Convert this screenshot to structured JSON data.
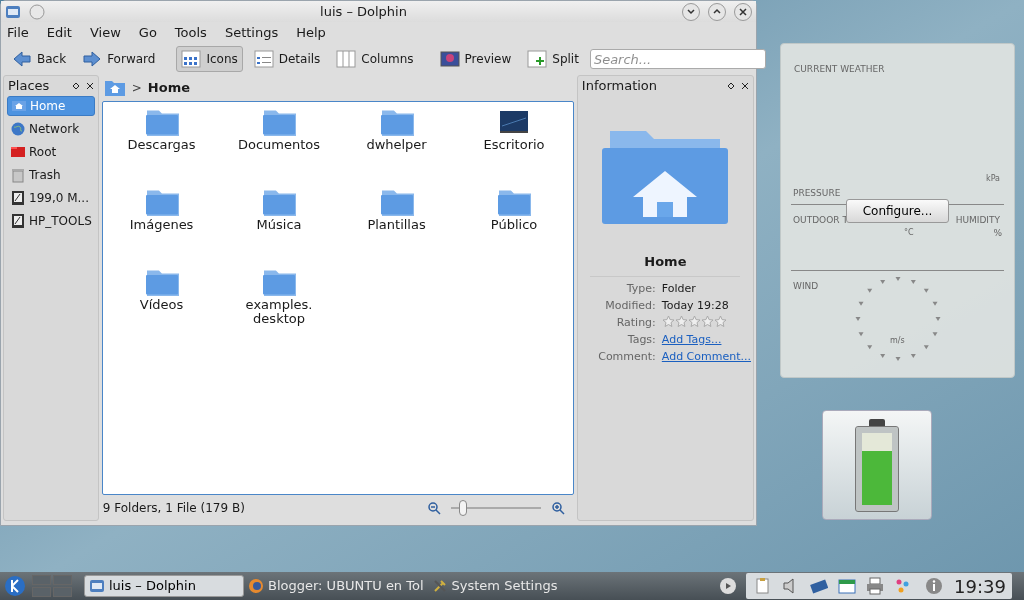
{
  "window": {
    "title": "luis – Dolphin"
  },
  "menu": [
    "File",
    "Edit",
    "View",
    "Go",
    "Tools",
    "Settings",
    "Help"
  ],
  "toolbar": [
    {
      "kind": "back",
      "label": "Back",
      "selected": false
    },
    {
      "kind": "forward",
      "label": "Forward",
      "selected": false
    },
    {
      "kind": "icons",
      "label": "Icons",
      "selected": true
    },
    {
      "kind": "details",
      "label": "Details",
      "selected": false
    },
    {
      "kind": "columns",
      "label": "Columns",
      "selected": false
    },
    {
      "kind": "preview",
      "label": "Preview",
      "selected": false
    },
    {
      "kind": "split",
      "label": "Split",
      "selected": false
    }
  ],
  "search": {
    "placeholder": "Search..."
  },
  "places": {
    "title": "Places",
    "items": [
      {
        "kind": "home",
        "label": "Home",
        "selected": true
      },
      {
        "kind": "network",
        "label": "Network",
        "selected": false
      },
      {
        "kind": "root",
        "label": "Root",
        "selected": false
      },
      {
        "kind": "trash",
        "label": "Trash",
        "selected": false
      },
      {
        "kind": "drive",
        "label": "199,0 M...",
        "selected": false
      },
      {
        "kind": "drive",
        "label": "HP_TOOLS",
        "selected": false
      }
    ]
  },
  "breadcrumb": {
    "separator": ">",
    "current": "Home"
  },
  "files": [
    {
      "kind": "folder",
      "name": "Descargas"
    },
    {
      "kind": "folder",
      "name": "Documentos"
    },
    {
      "kind": "folder",
      "name": "dwhelper"
    },
    {
      "kind": "desktop",
      "name": "Escritorio"
    },
    {
      "kind": "folder",
      "name": "Imágenes"
    },
    {
      "kind": "folder",
      "name": "Música"
    },
    {
      "kind": "folder",
      "name": "Plantillas"
    },
    {
      "kind": "folder",
      "name": "Público"
    },
    {
      "kind": "folder",
      "name": "Vídeos"
    },
    {
      "kind": "folder",
      "name": "examples.\ndesktop"
    }
  ],
  "status_bar": {
    "text": "9 Folders, 1 File (179 B)",
    "zoom": {
      "level": 0.1
    }
  },
  "information": {
    "title": "Information",
    "name": "Home",
    "fields": [
      {
        "kind": "text",
        "label": "Type:",
        "value": "Folder"
      },
      {
        "kind": "text",
        "label": "Modified:",
        "value": "Today 19:28"
      },
      {
        "kind": "rating",
        "label": "Rating:",
        "stars": 0
      },
      {
        "kind": "link",
        "label": "Tags:",
        "value": "Add Tags..."
      },
      {
        "kind": "link",
        "label": "Comment:",
        "value": "Add Comment..."
      }
    ]
  },
  "weather": {
    "title": "CURRENT WEATHER",
    "pressure_unit": "kPa",
    "pressure": "PRESSURE",
    "outdoor": "OUTDOOR T",
    "humidity": "HUMIDITY",
    "temp_unit": "°C",
    "humidity_unit": "%",
    "wind": "WIND",
    "wind_unit": "m/s",
    "button": "Configure..."
  },
  "battery": {
    "level": 0.75
  },
  "taskbar": {
    "tasks": [
      {
        "label": "luis – Dolphin",
        "kind": "files",
        "selected": true
      },
      {
        "label": "Blogger: UBUNTU en Tol",
        "kind": "browser",
        "selected": false
      },
      {
        "label": "System Settings",
        "kind": "settings",
        "selected": false
      }
    ],
    "clock": "19:39"
  }
}
